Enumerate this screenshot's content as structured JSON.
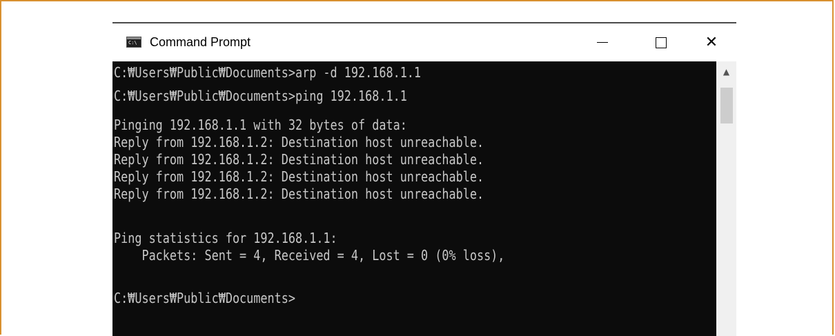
{
  "window": {
    "title": "Command Prompt",
    "icon_text": "C:\\"
  },
  "console": {
    "lines": [
      "C:₩Users₩Public₩Documents>arp -d 192.168.1.1",
      "C:₩Users₩Public₩Documents>ping 192.168.1.1",
      "Pinging 192.168.1.1 with 32 bytes of data:",
      "Reply from 192.168.1.2: Destination host unreachable.",
      "Reply from 192.168.1.2: Destination host unreachable.",
      "Reply from 192.168.1.2: Destination host unreachable.",
      "Reply from 192.168.1.2: Destination host unreachable.",
      "Ping statistics for 192.168.1.1:",
      "    Packets: Sent = 4, Received = 4, Lost = 0 (0% loss),",
      "C:₩Users₩Public₩Documents>"
    ]
  },
  "colors": {
    "frame_border": "#d9902f",
    "console_bg": "#0c0c0c",
    "console_text": "#c8c8c8"
  }
}
